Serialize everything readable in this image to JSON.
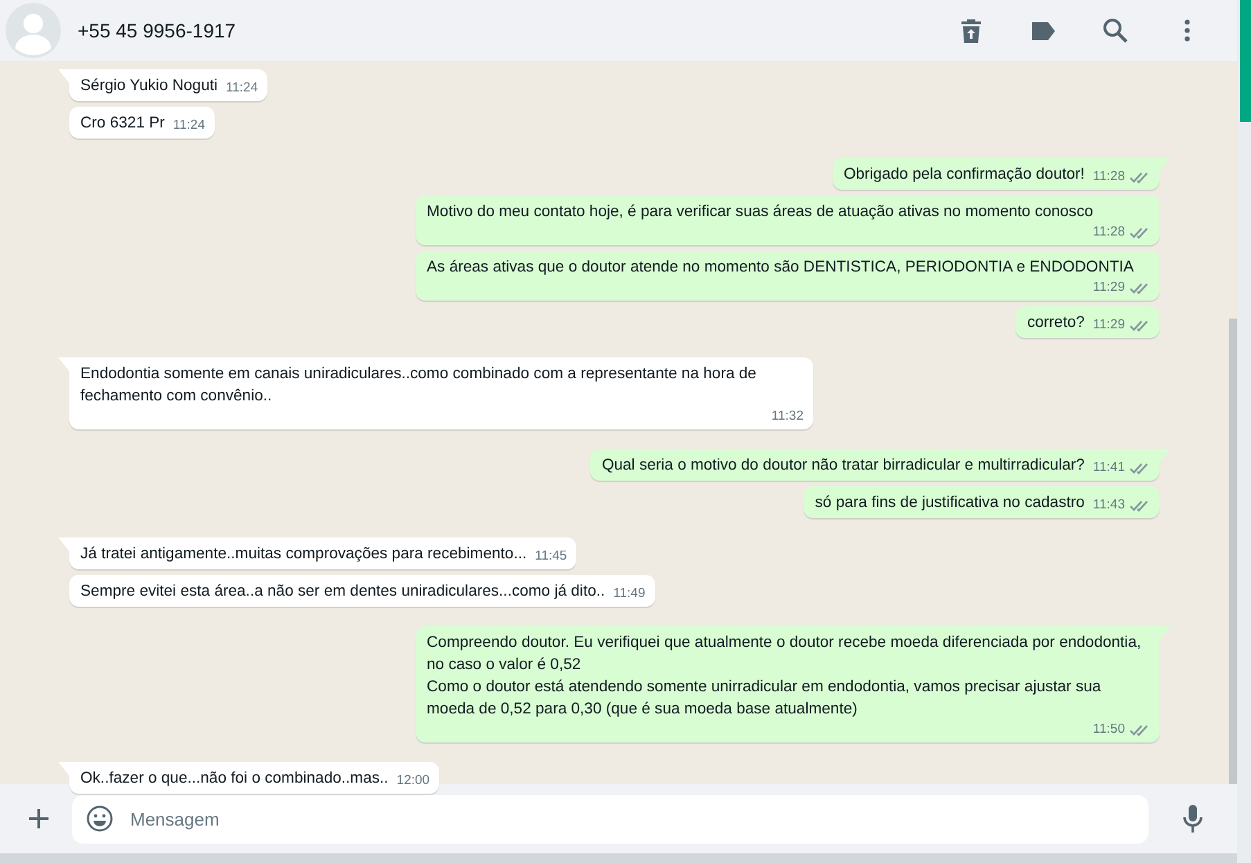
{
  "header": {
    "contact": "+55 45 9956-1917"
  },
  "messages": [
    {
      "kind": "incoming",
      "tail": true,
      "text": "Sérgio Yukio Noguti",
      "time": "11:24"
    },
    {
      "kind": "incoming",
      "tail": false,
      "text": "Cro 6321 Pr",
      "time": "11:24"
    },
    {
      "kind": "outgoing",
      "tail": true,
      "text": "Obrigado pela confirmação doutor!",
      "time": "11:28",
      "read": false
    },
    {
      "kind": "outgoing",
      "tail": false,
      "text": "Motivo do meu contato hoje, é para verificar suas áreas de atuação ativas no momento conosco",
      "time": "11:28",
      "read": false
    },
    {
      "kind": "outgoing",
      "tail": false,
      "text": "As áreas ativas que o doutor atende no momento são DENTISTICA, PERIODONTIA e ENDODONTIA",
      "time": "11:29",
      "read": false
    },
    {
      "kind": "outgoing",
      "tail": false,
      "text": "correto?",
      "time": "11:29",
      "read": false
    },
    {
      "kind": "incoming",
      "tail": true,
      "text": "Endodontia somente em canais uniradiculares..como combinado com a representante na hora de fechamento com convênio..",
      "time": "11:32"
    },
    {
      "kind": "outgoing",
      "tail": true,
      "text": "Qual seria o motivo do doutor não tratar birradicular e multirradicular?",
      "time": "11:41",
      "read": false
    },
    {
      "kind": "outgoing",
      "tail": false,
      "text": "só para fins de justificativa no cadastro",
      "time": "11:43",
      "read": false
    },
    {
      "kind": "incoming",
      "tail": true,
      "text": "Já tratei antigamente..muitas comprovações para recebimento...",
      "time": "11:45"
    },
    {
      "kind": "incoming",
      "tail": false,
      "text": "Sempre evitei esta área..a não ser em dentes uniradiculares...como já dito..",
      "time": "11:49"
    },
    {
      "kind": "outgoing",
      "tail": true,
      "text": "Compreendo doutor. Eu verifiquei que atualmente o doutor recebe moeda diferenciada por endodontia, no caso o valor é 0,52\nComo o doutor está atendendo somente unirradicular em endodontia, vamos precisar ajustar sua moeda de 0,52 para 0,30 (que é sua moeda base atualmente)",
      "time": "11:50",
      "read": false
    },
    {
      "kind": "incoming",
      "tail": true,
      "text": "Ok..fazer o que...não foi o combinado..mas..",
      "time": "12:00"
    }
  ],
  "composer": {
    "placeholder": "Mensagem"
  }
}
